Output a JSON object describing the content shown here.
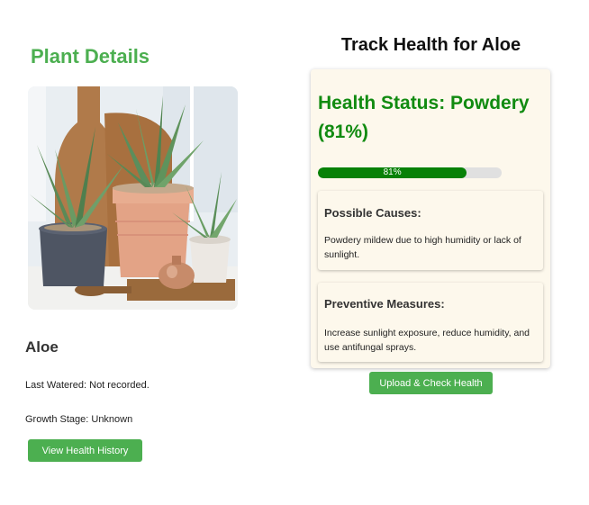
{
  "left_panel": {
    "title": "Plant Details",
    "plant_name": "Aloe",
    "last_watered": "Last Watered: Not recorded.",
    "growth_stage": "Growth Stage: Unknown",
    "history_button": "View Health History"
  },
  "right_panel": {
    "title": "Track Health for Aloe",
    "status_heading": "Health Status: Powdery (81%)",
    "health_percent": 81,
    "progress_label": "81%",
    "causes_title": "Possible Causes:",
    "causes_text": "Powdery mildew due to high humidity or lack of sunlight.",
    "measures_title": "Preventive Measures:",
    "measures_text": "Increase sunlight exposure, reduce humidity, and use antifungal sprays.",
    "upload_button": "Upload & Check Health"
  },
  "colors": {
    "accent_green": "#4caf50",
    "status_green": "#118b11",
    "progress_green": "#078107",
    "card_background": "#fdf8ec"
  }
}
